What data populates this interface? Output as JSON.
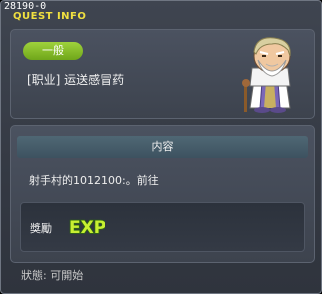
{
  "window": {
    "quest_id": "28190-0",
    "title": "QUEST INFO"
  },
  "header": {
    "category_badge": "一般",
    "quest_name": "[职业] 运送感冒药"
  },
  "content": {
    "section_title": "内容",
    "description": "射手村的1012100:。前往",
    "reward_label": "獎勵",
    "reward_icon": "exp-icon"
  },
  "status": {
    "text": "狀態: 可開始"
  },
  "colors": {
    "title": "#f0e040",
    "badge": "#8cc22a",
    "exp_fill": "#c8f032",
    "exp_outline": "#2f6a10"
  }
}
